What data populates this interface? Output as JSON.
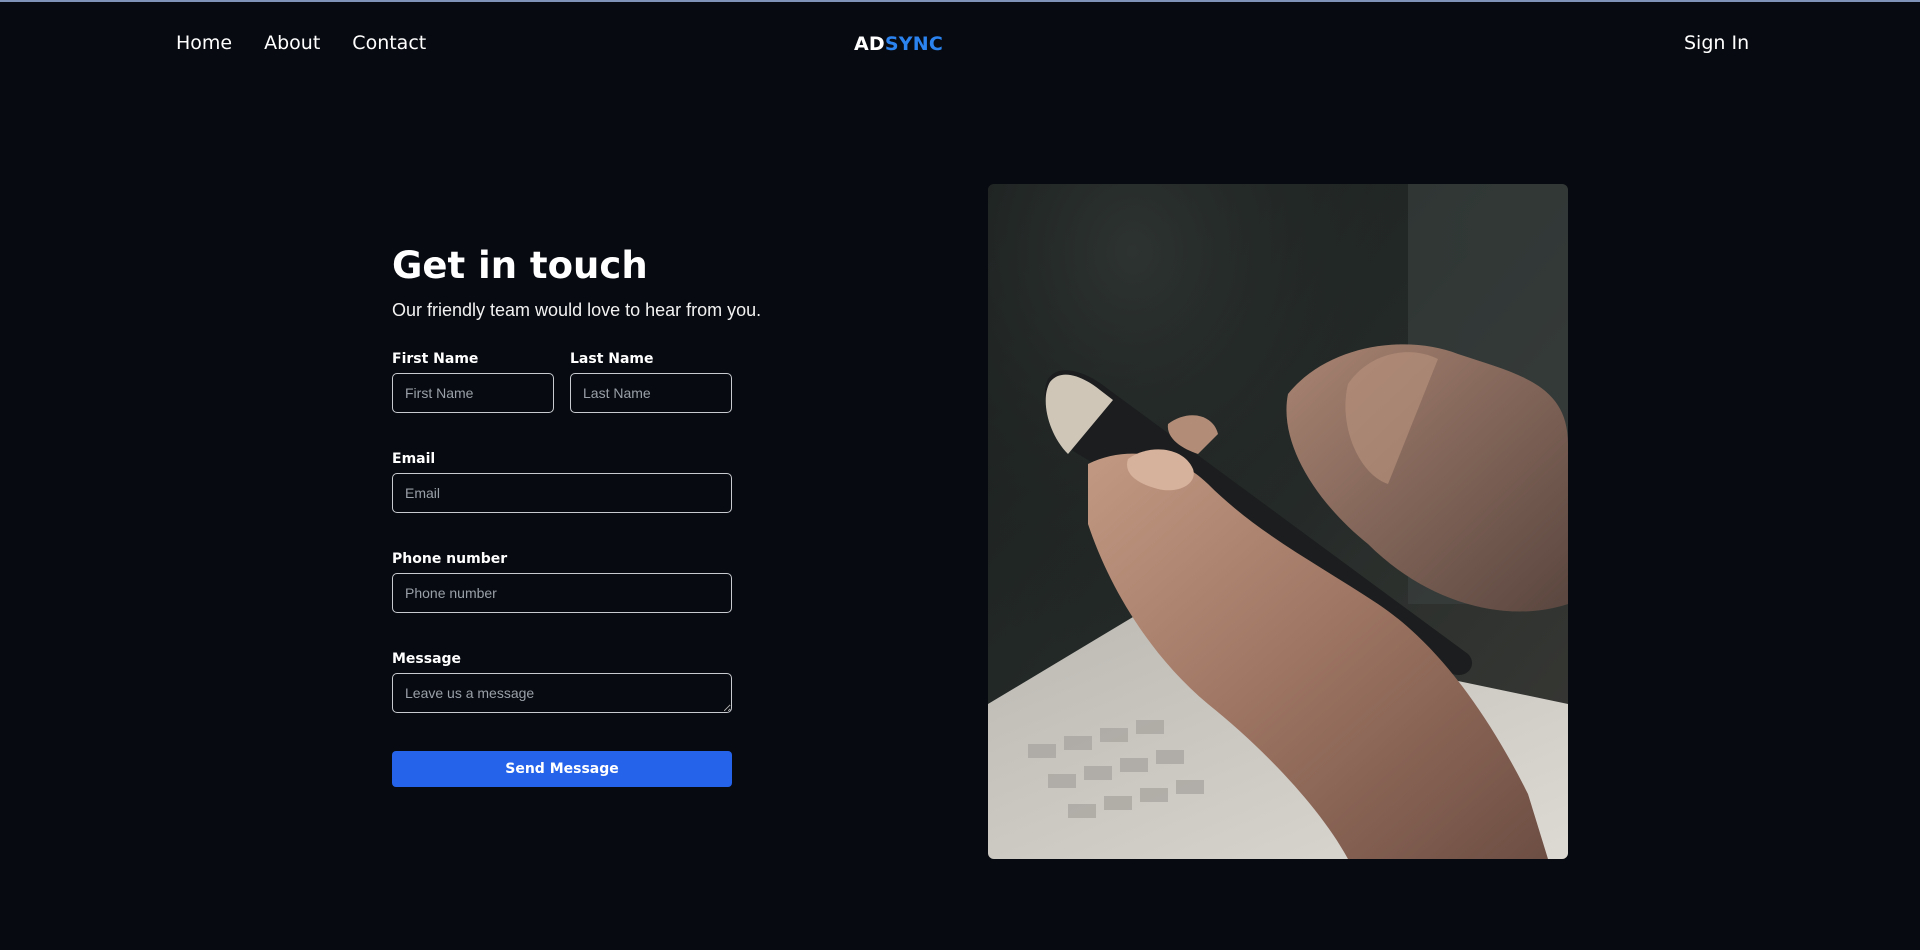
{
  "nav": {
    "links": [
      "Home",
      "About",
      "Contact"
    ],
    "logo_part1": "AD",
    "logo_part2": "SYNC",
    "signin": "Sign In"
  },
  "contact": {
    "title": "Get in touch",
    "subtitle": "Our friendly team would love to hear from you.",
    "first_name_label": "First Name",
    "first_name_placeholder": "First Name",
    "last_name_label": "Last Name",
    "last_name_placeholder": "Last Name",
    "email_label": "Email",
    "email_placeholder": "Email",
    "phone_label": "Phone number",
    "phone_placeholder": "Phone number",
    "message_label": "Message",
    "message_placeholder": "Leave us a message",
    "send_label": "Send Message"
  },
  "colors": {
    "background": "#070a10",
    "accent": "#2563eb",
    "logo_blue": "#2b83f0"
  },
  "image": {
    "icon": "hands-holding-smartphone-photo"
  }
}
